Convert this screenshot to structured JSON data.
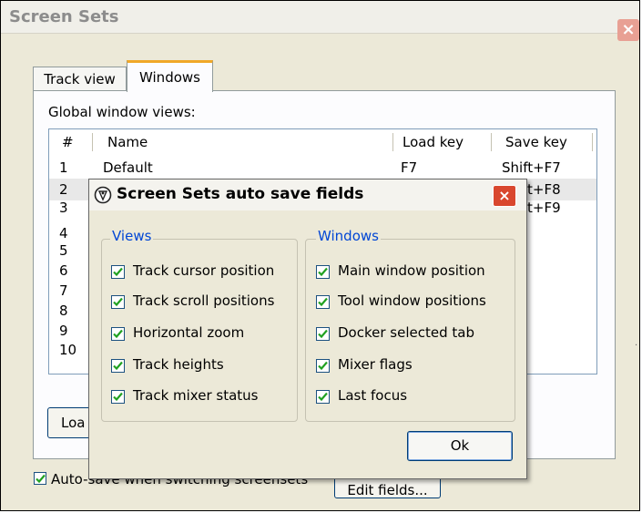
{
  "outer": {
    "title": "Screen Sets",
    "close_symbol": "×",
    "tabs": [
      "Track view",
      "Windows"
    ],
    "active_tab": "Windows",
    "list_label": "Global window views:",
    "columns": [
      "#",
      "Name",
      "Load key",
      "Save key"
    ],
    "rows": [
      {
        "num": "1",
        "name": "Default",
        "load": "F7",
        "save": "Shift+F7"
      },
      {
        "num": "2",
        "name": "",
        "load": "",
        "save": "t+F8"
      },
      {
        "num": "3",
        "name": "",
        "load": "",
        "save": "t+F9"
      },
      {
        "num": "4"
      },
      {
        "num": "5"
      },
      {
        "num": "6"
      },
      {
        "num": "7"
      },
      {
        "num": "8"
      },
      {
        "num": "9"
      },
      {
        "num": "10"
      }
    ],
    "load_button": "Loa",
    "autosave_label": "Auto-save when switching screensets",
    "autosave_checked": true,
    "edit_fields_button": "Edit fields..."
  },
  "dialog": {
    "title": "Screen Sets auto save fields",
    "close_symbol": "×",
    "views_group": {
      "title": "Views",
      "options": [
        {
          "label": "Track cursor position",
          "checked": true
        },
        {
          "label": "Track scroll positions",
          "checked": true
        },
        {
          "label": "Horizontal zoom",
          "checked": true
        },
        {
          "label": "Track heights",
          "checked": true
        },
        {
          "label": "Track mixer status",
          "checked": true
        }
      ]
    },
    "windows_group": {
      "title": "Windows",
      "options": [
        {
          "label": "Main window position",
          "checked": true
        },
        {
          "label": "Tool window positions",
          "checked": true
        },
        {
          "label": "Docker selected tab",
          "checked": true
        },
        {
          "label": "Mixer flags",
          "checked": true
        },
        {
          "label": "Last focus",
          "checked": true
        }
      ]
    },
    "ok_button": "Ok"
  },
  "colors": {
    "group_title": "#0046d5",
    "active_tab_accent": "#f0a828",
    "close_red": "#d9472e",
    "checkmark_green": "#21a121"
  }
}
